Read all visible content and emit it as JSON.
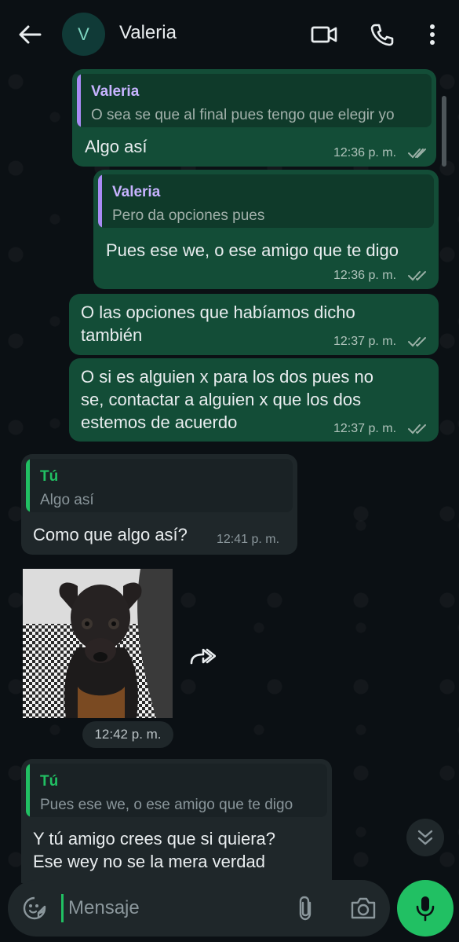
{
  "header": {
    "avatar_letter": "V",
    "contact_name": "Valeria"
  },
  "messages": [
    {
      "direction": "outgoing",
      "quote": {
        "name": "Valeria",
        "text": "O sea se que al final pues tengo que elegir yo"
      },
      "lines": [
        "Algo así"
      ],
      "time": "12:36 p. m.",
      "status": "read"
    },
    {
      "direction": "outgoing",
      "quote": {
        "name": "Valeria",
        "text": "Pero da opciones pues"
      },
      "lines": [
        "Pues ese we, o ese amigo que te digo"
      ],
      "time": "12:36 p. m.",
      "status": "read"
    },
    {
      "direction": "outgoing",
      "lines": [
        "O las opciones que habíamos dicho",
        "también"
      ],
      "time": "12:37 p. m.",
      "status": "read"
    },
    {
      "direction": "outgoing",
      "lines": [
        "O si es alguien x para los dos pues no",
        "se, contactar a alguien x que los dos",
        "estemos de acuerdo"
      ],
      "time": "12:37 p. m.",
      "status": "read"
    },
    {
      "direction": "incoming",
      "quote": {
        "name": "Tú",
        "text": "Algo así"
      },
      "lines": [
        "Como que algo así?"
      ],
      "time": "12:41 p. m."
    },
    {
      "direction": "incoming",
      "type": "image",
      "time": "12:42 p. m."
    },
    {
      "direction": "incoming",
      "quote": {
        "name": "Tú",
        "text": "Pues ese we, o ese amigo que te digo"
      },
      "lines": [
        "Y tú amigo crees que si quiera?",
        "Ese wey no se la mera verdad"
      ]
    }
  ],
  "input": {
    "placeholder": "Mensaje"
  },
  "colors": {
    "outgoing_bubble": "#134d37",
    "incoming_bubble": "#1f272a",
    "quote_bar_valeria": "#a98bf5",
    "quote_bar_you": "#21c063",
    "quote_name_valeria": "#c7b3ff",
    "quote_name_you": "#21c063",
    "read_ticks": "#9ab0a6",
    "mic_button": "#21c063"
  },
  "icons": {
    "back": "arrow-left-icon",
    "video": "video-camera-icon",
    "call": "phone-icon",
    "menu": "more-vertical-icon",
    "forward": "forward-arrow-icon",
    "scroll_down": "double-chevron-down-icon",
    "emoji": "sticker-smiley-icon",
    "attach": "paperclip-icon",
    "camera": "camera-icon",
    "mic": "microphone-icon"
  }
}
